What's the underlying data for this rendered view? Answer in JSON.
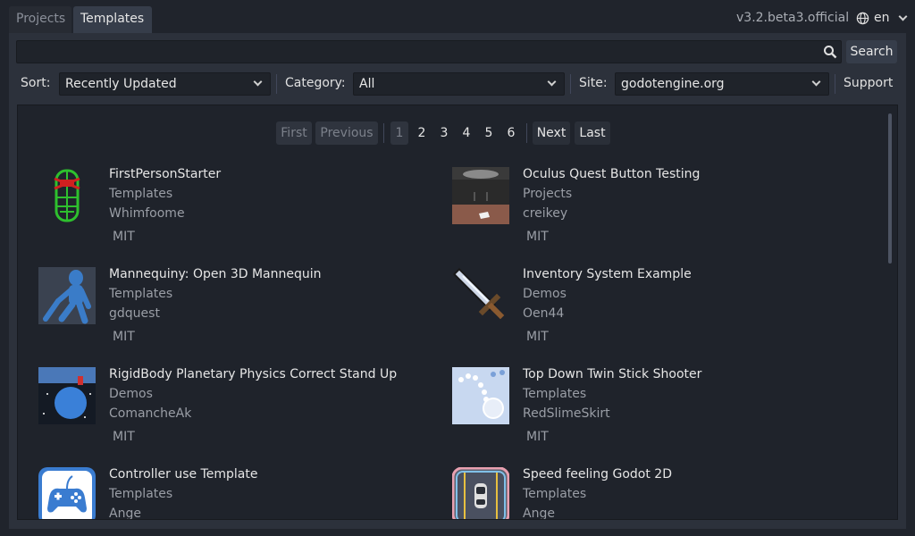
{
  "tabs": {
    "projects": "Projects",
    "templates": "Templates"
  },
  "version": "v3.2.beta3.official",
  "language": "en",
  "search": {
    "value": "",
    "placeholder": "",
    "button": "Search"
  },
  "filters": {
    "sort_label": "Sort:",
    "sort_value": "Recently Updated",
    "category_label": "Category:",
    "category_value": "All",
    "site_label": "Site:",
    "site_value": "godotengine.org",
    "support": "Support"
  },
  "pager": {
    "first": "First",
    "previous": "Previous",
    "pages": [
      "1",
      "2",
      "3",
      "4",
      "5",
      "6"
    ],
    "current_page": "1",
    "next": "Next",
    "last": "Last"
  },
  "assets": [
    {
      "title": "FirstPersonStarter",
      "category": "Templates",
      "author": "Whimfoome",
      "license": "MIT",
      "icon": "green-wireframe-character-icon"
    },
    {
      "title": "Oculus Quest Button Testing",
      "category": "Projects",
      "author": "creikey",
      "license": "MIT",
      "icon": "vr-room-screenshot"
    },
    {
      "title": "Mannequiny: Open 3D Mannequin",
      "category": "Templates",
      "author": "gdquest",
      "license": "MIT",
      "icon": "blue-mannequin-icon"
    },
    {
      "title": "Inventory System Example",
      "category": "Demos",
      "author": "Oen44",
      "license": "MIT",
      "icon": "pixel-sword-icon"
    },
    {
      "title": "RigidBody Planetary Physics Correct Stand Up",
      "category": "Demos",
      "author": "ComancheAk",
      "license": "MIT",
      "icon": "planet-screenshot"
    },
    {
      "title": "Top Down Twin Stick Shooter",
      "category": "Templates",
      "author": "RedSlimeSkirt",
      "license": "MIT",
      "icon": "bullet-trail-screenshot"
    },
    {
      "title": "Controller use Template",
      "category": "Templates",
      "author": "Ange",
      "license": "",
      "icon": "gamepad-icon"
    },
    {
      "title": "Speed feeling Godot 2D",
      "category": "Templates",
      "author": "Ange",
      "license": "",
      "icon": "car-road-icon"
    }
  ],
  "colors": {
    "background": "#20242c",
    "panel": "#2c313b",
    "content": "#1f232b",
    "accent": "#e6e6e6"
  }
}
